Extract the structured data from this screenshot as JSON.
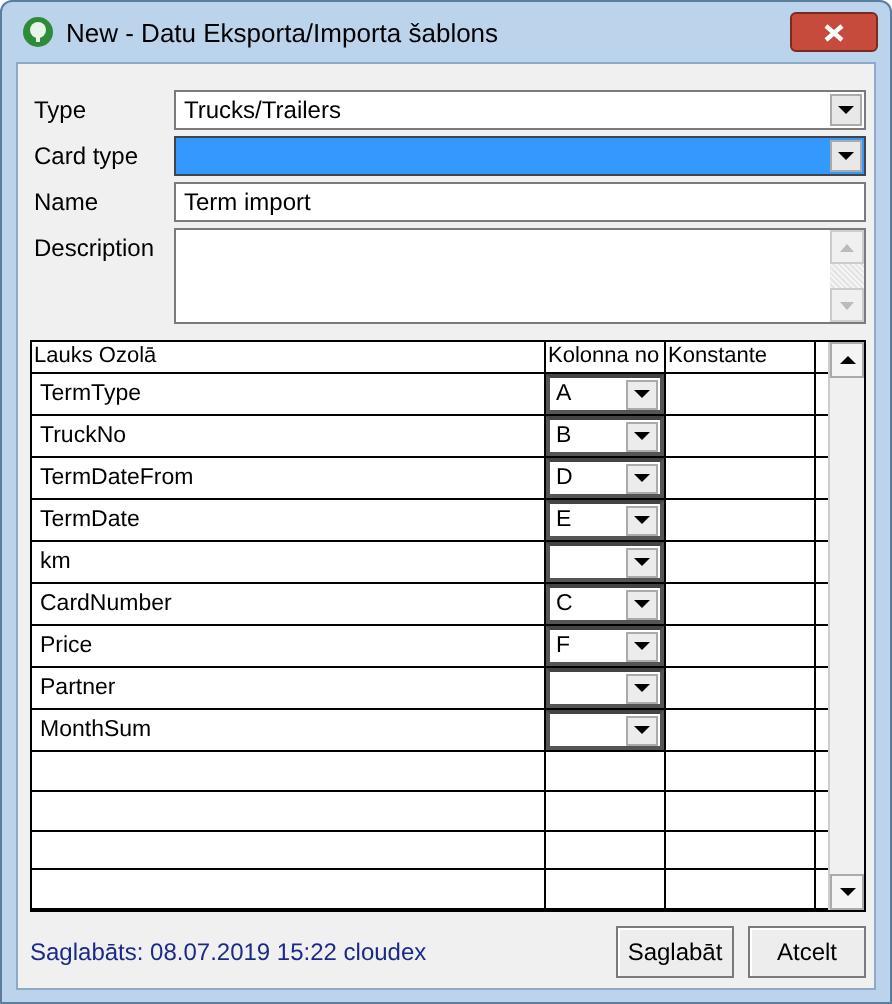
{
  "window": {
    "title": "New - Datu Eksporta/Importa šablons"
  },
  "form": [
    {
      "kind": "dropdown",
      "label": "Type",
      "value": "Trucks/Trailers",
      "highlighted": false
    },
    {
      "kind": "dropdown",
      "label": "Card type",
      "highlighted": true
    },
    {
      "kind": "text",
      "label": "Name",
      "value": "Term import"
    },
    {
      "kind": "memo",
      "label": "Description"
    }
  ],
  "table": {
    "columns": [
      "Lauks Ozolā",
      "Kolonna no",
      "Konstante"
    ],
    "rows": [
      {
        "field": "TermType",
        "column": "A"
      },
      {
        "field": "TruckNo",
        "column": "B"
      },
      {
        "field": "TermDateFrom",
        "column": "D"
      },
      {
        "field": "TermDate",
        "column": "E"
      },
      {
        "field": "km"
      },
      {
        "field": "CardNumber",
        "column": "C"
      },
      {
        "field": "Price",
        "column": "F"
      },
      {
        "field": "Partner"
      },
      {
        "field": "MonthSum"
      }
    ]
  },
  "status": "Saglabāts: 08.07.2019 15:22 cloudex",
  "buttons": [
    "Saglabāt",
    "Atcelt"
  ]
}
